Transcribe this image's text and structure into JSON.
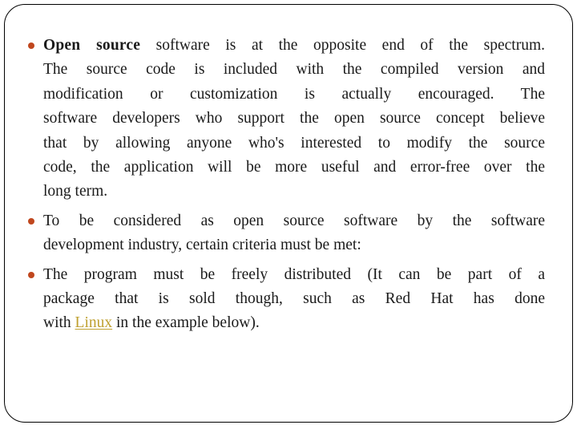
{
  "slide": {
    "frame_color": "#000000",
    "background_color": "#ffffff",
    "bullet_color": "#C0471E",
    "text_color": "#1a1a1a",
    "link_color": "#BFA030"
  },
  "bullets": [
    {
      "lead": "Open source",
      "lead_bold": true,
      "lines": [
        " software is at the opposite end of the spectrum.",
        "The source code is included with the compiled version and",
        "modification or customization is actually encouraged. The",
        "software developers who support the open source concept believe",
        "that by allowing anyone who's interested to modify the source",
        "code, the application will be more useful and error-free over the",
        "long term."
      ],
      "full_text": "Open source software is at the opposite end of the spectrum. The source code is included with the compiled version and modification or customization is actually encouraged. The software developers who support the open source concept believe that by allowing anyone who's interested to modify the source code, the application will be more useful and error-free over the long term."
    },
    {
      "lead": "",
      "lead_bold": false,
      "lines": [
        "To be considered as open source software by the software",
        "development industry, certain criteria must be met:"
      ],
      "full_text": "To be considered as open source software by the software development industry, certain criteria must be met:"
    },
    {
      "lead": "",
      "lead_bold": false,
      "lines": [
        "The program must be freely distributed (It can be part of a",
        "package that is sold though, such as Red Hat has done",
        "with "
      ],
      "link_text": "Linux",
      "line_after_link": " in the example below).",
      "full_text": "The program must be freely distributed (It can be part of a package that is sold though, such as Red Hat has done with Linux in the example below)."
    }
  ]
}
